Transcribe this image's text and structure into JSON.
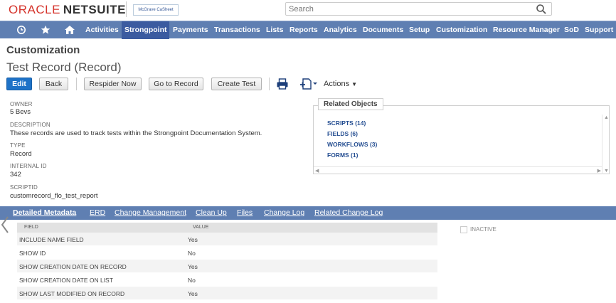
{
  "header": {
    "logo_oracle": "ORACLE",
    "logo_netsuite": "NETSUITE",
    "client_logo": "McGrave CaSheet",
    "search_placeholder": "Search"
  },
  "nav": {
    "items": [
      "Activities",
      "Strongpoint",
      "Payments",
      "Transactions",
      "Lists",
      "Reports",
      "Analytics",
      "Documents",
      "Setup",
      "Customization",
      "Resource Manager",
      "SoD",
      "Support"
    ],
    "active": "Strongpoint",
    "icons": [
      "recent-icon",
      "star-icon",
      "home-icon"
    ]
  },
  "page": {
    "category": "Customization",
    "title": "Test Record (Record)"
  },
  "buttons": {
    "edit": "Edit",
    "back": "Back",
    "respider": "Respider Now",
    "goto": "Go to Record",
    "create_test": "Create Test",
    "actions": "Actions"
  },
  "fields": {
    "owner_label": "OWNER",
    "owner_value": "5 Bevs",
    "description_label": "DESCRIPTION",
    "description_value": "These records are used to track tests within the Strongpoint Documentation System.",
    "type_label": "TYPE",
    "type_value": "Record",
    "internal_id_label": "INTERNAL ID",
    "internal_id_value": "342",
    "scriptid_label": "SCRIPTID",
    "scriptid_value": "customrecord_flo_test_report"
  },
  "related": {
    "title": "Related Objects",
    "links": [
      "SCRIPTS (14)",
      "FIELDS (6)",
      "WORKFLOWS (3)",
      "FORMS (1)"
    ]
  },
  "subtabs": {
    "items": [
      "Detailed Metadata",
      "ERD",
      "Change Management",
      "Clean Up",
      "Files",
      "Change Log",
      "Related Change Log"
    ],
    "active": "Detailed Metadata"
  },
  "table": {
    "headers": [
      "FIELD",
      "VALUE"
    ],
    "rows": [
      [
        "INCLUDE NAME FIELD",
        "Yes"
      ],
      [
        "SHOW ID",
        "No"
      ],
      [
        "SHOW CREATION DATE ON RECORD",
        "Yes"
      ],
      [
        "SHOW CREATION DATE ON LIST",
        "No"
      ],
      [
        "SHOW LAST MODIFIED ON RECORD",
        "Yes"
      ]
    ]
  },
  "inactive_label": "INACTIVE",
  "colors": {
    "nav_bg": "#5f7fb2",
    "nav_active": "#3b5ba0",
    "primary_button": "#1e72c7",
    "link": "#264f92",
    "oracle_red": "#d5332b"
  }
}
